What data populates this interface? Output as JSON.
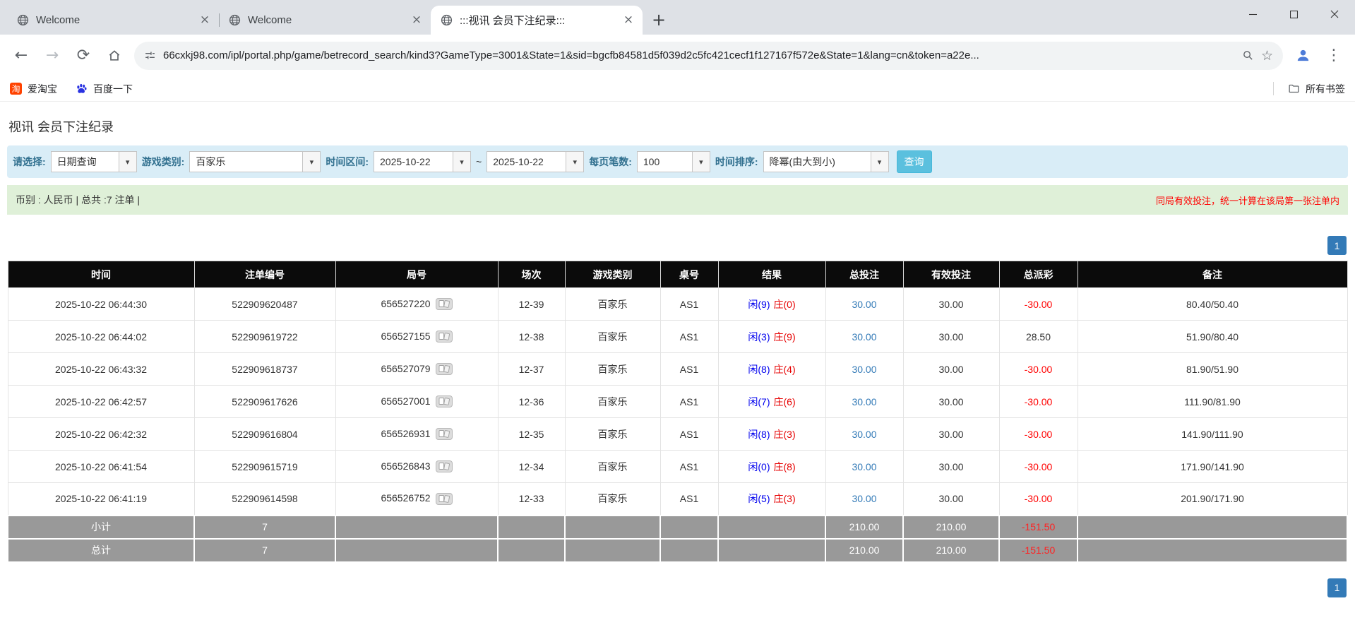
{
  "icons": {
    "close": "×",
    "new_tab": "+",
    "back": "←",
    "forward": "→",
    "refresh": "⟳",
    "star": "☆",
    "menu": "⋮",
    "dropdown": "▾",
    "taobao_glyph": "淘"
  },
  "browser": {
    "tabs": [
      {
        "label": "Welcome"
      },
      {
        "label": "Welcome"
      },
      {
        "label": ":::视讯 会员下注纪录:::"
      }
    ],
    "url": "66cxkj98.com/ipl/portal.php/game/betrecord_search/kind3?GameType=3001&State=1&sid=bgcfb84581d5f039d2c5fc421cecf1f127167f572e&State=1&lang=cn&token=a22e...",
    "bookmarks": [
      {
        "label": "爱淘宝"
      },
      {
        "label": "百度一下"
      }
    ],
    "all_bookmarks_label": "所有书签"
  },
  "page": {
    "title": "视讯 会员下注纪录",
    "filters": {
      "select_label": "请选择:",
      "select_value": "日期查询",
      "game_type_label": "游戏类别:",
      "game_type_value": "百家乐",
      "date_range_label": "时间区间:",
      "date_from": "2025-10-22",
      "date_separator": "~",
      "date_to": "2025-10-22",
      "per_page_label": "每页笔数:",
      "per_page_value": "100",
      "sort_label": "时间排序:",
      "sort_value": "降幂(由大到小)",
      "search_button_label": "查询"
    },
    "info_bar": {
      "left": "币别 : 人民币 | 总共 :7 注单 |",
      "right": "同局有效投注，统一计算在该局第一张注单内"
    },
    "pagination": {
      "page": "1"
    },
    "table": {
      "headers": [
        "时间",
        "注单编号",
        "局号",
        "场次",
        "游戏类别",
        "桌号",
        "结果",
        "总投注",
        "有效投注",
        "总派彩",
        "备注"
      ],
      "rows": [
        {
          "time": "2025-10-22 06:44:30",
          "bet_id": "522909620487",
          "round_id": "656527220",
          "session": "12-39",
          "game_type": "百家乐",
          "table_no": "AS1",
          "result_player": "闲(9)",
          "result_banker": "庄(0)",
          "total_bet": "30.00",
          "valid_bet": "30.00",
          "payout": "-30.00",
          "remark": "80.40/50.40"
        },
        {
          "time": "2025-10-22 06:44:02",
          "bet_id": "522909619722",
          "round_id": "656527155",
          "session": "12-38",
          "game_type": "百家乐",
          "table_no": "AS1",
          "result_player": "闲(3)",
          "result_banker": "庄(9)",
          "total_bet": "30.00",
          "valid_bet": "30.00",
          "payout": "28.50",
          "remark": "51.90/80.40"
        },
        {
          "time": "2025-10-22 06:43:32",
          "bet_id": "522909618737",
          "round_id": "656527079",
          "session": "12-37",
          "game_type": "百家乐",
          "table_no": "AS1",
          "result_player": "闲(8)",
          "result_banker": "庄(4)",
          "total_bet": "30.00",
          "valid_bet": "30.00",
          "payout": "-30.00",
          "remark": "81.90/51.90"
        },
        {
          "time": "2025-10-22 06:42:57",
          "bet_id": "522909617626",
          "round_id": "656527001",
          "session": "12-36",
          "game_type": "百家乐",
          "table_no": "AS1",
          "result_player": "闲(7)",
          "result_banker": "庄(6)",
          "total_bet": "30.00",
          "valid_bet": "30.00",
          "payout": "-30.00",
          "remark": "111.90/81.90"
        },
        {
          "time": "2025-10-22 06:42:32",
          "bet_id": "522909616804",
          "round_id": "656526931",
          "session": "12-35",
          "game_type": "百家乐",
          "table_no": "AS1",
          "result_player": "闲(8)",
          "result_banker": "庄(3)",
          "total_bet": "30.00",
          "valid_bet": "30.00",
          "payout": "-30.00",
          "remark": "141.90/111.90"
        },
        {
          "time": "2025-10-22 06:41:54",
          "bet_id": "522909615719",
          "round_id": "656526843",
          "session": "12-34",
          "game_type": "百家乐",
          "table_no": "AS1",
          "result_player": "闲(0)",
          "result_banker": "庄(8)",
          "total_bet": "30.00",
          "valid_bet": "30.00",
          "payout": "-30.00",
          "remark": "171.90/141.90"
        },
        {
          "time": "2025-10-22 06:41:19",
          "bet_id": "522909614598",
          "round_id": "656526752",
          "session": "12-33",
          "game_type": "百家乐",
          "table_no": "AS1",
          "result_player": "闲(5)",
          "result_banker": "庄(3)",
          "total_bet": "30.00",
          "valid_bet": "30.00",
          "payout": "-30.00",
          "remark": "201.90/171.90"
        }
      ],
      "subtotal": {
        "label": "小计",
        "count": "7",
        "total_bet": "210.00",
        "valid_bet": "210.00",
        "payout": "-151.50"
      },
      "total": {
        "label": "总计",
        "count": "7",
        "total_bet": "210.00",
        "valid_bet": "210.00",
        "payout": "-151.50"
      }
    }
  }
}
